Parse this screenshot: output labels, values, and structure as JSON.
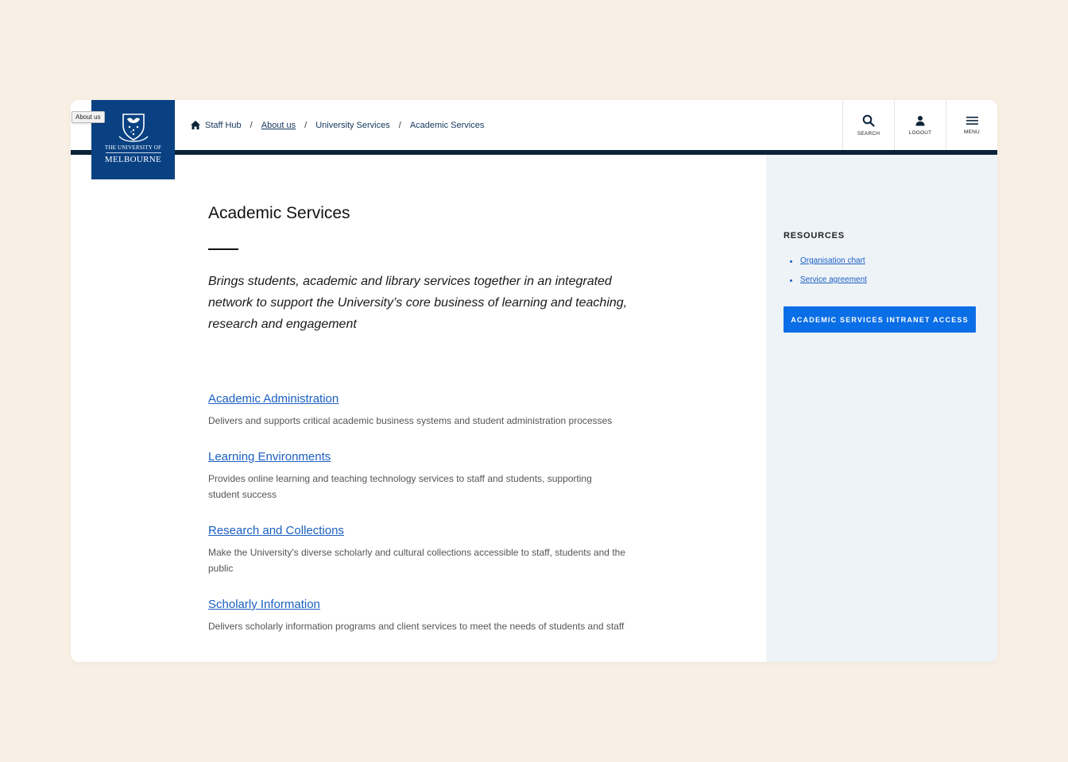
{
  "tooltip": "About us",
  "logo": {
    "line1": "THE UNIVERSITY OF",
    "line2": "MELBOURNE"
  },
  "breadcrumb": [
    {
      "label": "Staff Hub"
    },
    {
      "label": "About us"
    },
    {
      "label": "University Services"
    },
    {
      "label": "Academic Services"
    }
  ],
  "breadcrumb_separator": "/",
  "header_actions": {
    "search": "SEARCH",
    "logout": "LOGOUT",
    "menu": "MENU"
  },
  "page": {
    "title": "Academic Services",
    "intro": "Brings students, academic and library services together in an integrated network to support the University’s core business of learning and teaching, research and engagement"
  },
  "services": [
    {
      "title": "Academic Administration",
      "desc": "Delivers and supports critical academic business systems and student administration processes"
    },
    {
      "title": "Learning Environments",
      "desc": "Provides online learning and teaching technology services to staff and students, supporting student success"
    },
    {
      "title": "Research and Collections",
      "desc": "Make the University's diverse scholarly and cultural collections accessible to staff, students and the public"
    },
    {
      "title": "Scholarly Information",
      "desc": "Delivers scholarly information programs and client services to meet the needs of students and staff"
    }
  ],
  "resources": {
    "heading": "RESOURCES",
    "links": [
      {
        "label": "Organisation chart"
      },
      {
        "label": "Service agreement"
      }
    ],
    "button": "ACADEMIC SERVICES INTRANET ACCESS"
  },
  "colors": {
    "background": "#f8f0e4",
    "brand_navy": "#094183",
    "header_bar": "#0b2338",
    "link_blue": "#1b5fc1",
    "button_blue": "#0a6ee6",
    "aside_bg": "#eef3f8"
  }
}
